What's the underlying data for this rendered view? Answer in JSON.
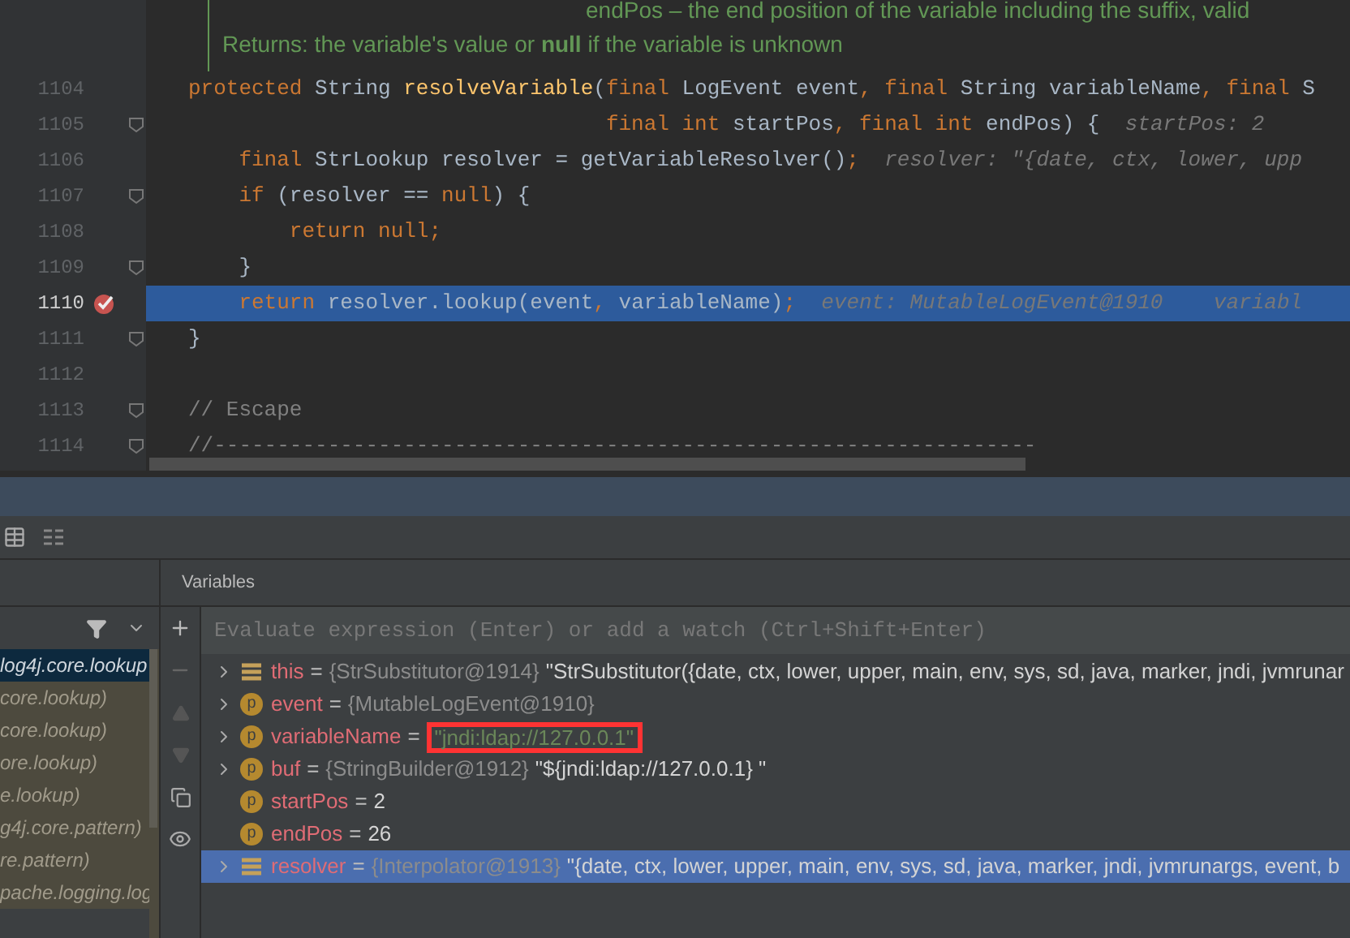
{
  "doc_comment": [
    "endPos – the end position of the variable including the suffix, valid",
    "Returns: the variable's value or **null** if the variable is unknown"
  ],
  "code_lines": [
    {
      "number": "1104",
      "fold": false,
      "breakpoint": false,
      "current": false,
      "segments": [
        {
          "kind": "keyword",
          "text": "protected "
        },
        {
          "kind": "plain",
          "text": "String "
        },
        {
          "kind": "method",
          "text": "resolveVariable"
        },
        {
          "kind": "plain",
          "text": "("
        },
        {
          "kind": "keyword",
          "text": "final "
        },
        {
          "kind": "plain",
          "text": "LogEvent event"
        },
        {
          "kind": "keyword",
          "text": ", final "
        },
        {
          "kind": "plain",
          "text": "String variableName"
        },
        {
          "kind": "keyword",
          "text": ", final "
        },
        {
          "kind": "plain",
          "text": "S"
        }
      ]
    },
    {
      "number": "1105",
      "fold": true,
      "breakpoint": false,
      "current": false,
      "segments": [
        {
          "kind": "keyword",
          "text": "                                 final int "
        },
        {
          "kind": "plain",
          "text": "startPos"
        },
        {
          "kind": "keyword",
          "text": ", final int "
        },
        {
          "kind": "plain",
          "text": "endPos) {  "
        },
        {
          "kind": "hint",
          "text": "startPos: 2"
        }
      ]
    },
    {
      "number": "1106",
      "fold": false,
      "breakpoint": false,
      "current": false,
      "segments": [
        {
          "kind": "keyword",
          "text": "    final "
        },
        {
          "kind": "plain",
          "text": "StrLookup resolver = getVariableResolver()"
        },
        {
          "kind": "keyword",
          "text": ";  "
        },
        {
          "kind": "hint",
          "text": "resolver: \"{date, ctx, lower, upp"
        }
      ]
    },
    {
      "number": "1107",
      "fold": true,
      "breakpoint": false,
      "current": false,
      "segments": [
        {
          "kind": "keyword",
          "text": "    if "
        },
        {
          "kind": "plain",
          "text": "(resolver == "
        },
        {
          "kind": "keyword",
          "text": "null"
        },
        {
          "kind": "plain",
          "text": ") {"
        }
      ]
    },
    {
      "number": "1108",
      "fold": false,
      "breakpoint": false,
      "current": false,
      "segments": [
        {
          "kind": "keyword",
          "text": "        return null;"
        }
      ]
    },
    {
      "number": "1109",
      "fold": true,
      "breakpoint": false,
      "current": false,
      "segments": [
        {
          "kind": "plain",
          "text": "    }"
        }
      ]
    },
    {
      "number": "1110",
      "fold": false,
      "breakpoint": true,
      "current": true,
      "segments": [
        {
          "kind": "keyword",
          "text": "    return "
        },
        {
          "kind": "plain",
          "text": "resolver.lookup(event"
        },
        {
          "kind": "keyword",
          "text": ", "
        },
        {
          "kind": "plain",
          "text": "variableName)"
        },
        {
          "kind": "keyword",
          "text": ";  "
        },
        {
          "kind": "hint",
          "text": "event: MutableLogEvent@1910    variabl"
        }
      ]
    },
    {
      "number": "1111",
      "fold": true,
      "breakpoint": false,
      "current": false,
      "segments": [
        {
          "kind": "plain",
          "text": "}"
        }
      ]
    },
    {
      "number": "1112",
      "fold": false,
      "breakpoint": false,
      "current": false
    },
    {
      "number": "1113",
      "fold": true,
      "breakpoint": false,
      "current": false,
      "segments": [
        {
          "kind": "comment",
          "text": "// Escape"
        }
      ]
    },
    {
      "number": "1114",
      "fold": true,
      "breakpoint": false,
      "current": false,
      "segments": [
        {
          "kind": "comment",
          "text": "//-----------------------------------------------------------------"
        }
      ]
    }
  ],
  "frames": [
    {
      "text": "log4j.core.lookup",
      "selected": true
    },
    {
      "text": "core.lookup)",
      "selected": false
    },
    {
      "text": "core.lookup)",
      "selected": false
    },
    {
      "text": "ore.lookup)",
      "selected": false
    },
    {
      "text": "e.lookup)",
      "selected": false
    },
    {
      "text": "g4j.core.pattern)",
      "selected": false
    },
    {
      "text": "re.pattern)",
      "selected": false
    },
    {
      "text": "pache.logging.log",
      "selected": false
    }
  ],
  "variables_title": "Variables",
  "evaluate": {
    "placeholder": "Evaluate expression (Enter) or add a watch (Ctrl+Shift+Enter)"
  },
  "variables": [
    {
      "kind": "object",
      "expandable": true,
      "selected": false,
      "name": "this",
      "separator": "=",
      "ref": "{StrSubstitutor@1914}",
      "value": "\"StrSubstitutor({date, ctx, lower, upper, main, env, sys, sd, java, marker, jndi, jvmrunar"
    },
    {
      "kind": "param",
      "badge": "p",
      "expandable": true,
      "selected": false,
      "name": "event",
      "separator": "=",
      "ref": "{MutableLogEvent@1910}"
    },
    {
      "kind": "param",
      "badge": "p",
      "expandable": true,
      "selected": false,
      "highlighted": true,
      "name": "variableName",
      "separator": "=",
      "value": "\"jndi:ldap://127.0.0.1\"",
      "literal": true
    },
    {
      "kind": "param",
      "badge": "p",
      "expandable": true,
      "selected": false,
      "name": "buf",
      "separator": "=",
      "ref": "{StringBuilder@1912}",
      "value": "\"${jndi:ldap://127.0.0.1} \""
    },
    {
      "kind": "param",
      "badge": "p",
      "expandable": false,
      "selected": false,
      "name": "startPos",
      "separator": "=",
      "value": "2"
    },
    {
      "kind": "param",
      "badge": "p",
      "expandable": false,
      "selected": false,
      "name": "endPos",
      "separator": "=",
      "value": "26"
    },
    {
      "kind": "object",
      "expandable": true,
      "selected": true,
      "name": "resolver",
      "separator": "=",
      "ref": "{Interpolator@1913}",
      "value": "\"{date, ctx, lower, upper, main, env, sys, sd, java, marker, jndi, jvmrunargs, event, b"
    }
  ]
}
